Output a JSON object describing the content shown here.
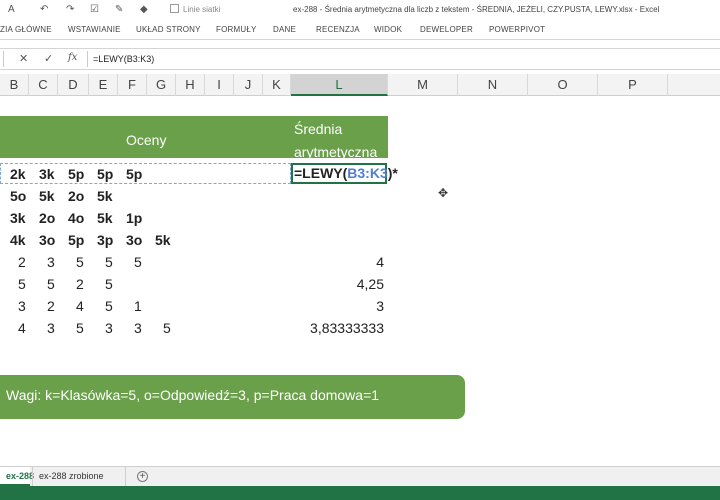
{
  "title_bar": {
    "gridlines_label": "Linie siatki",
    "window_title": "ex-288 - Średnia arytmetyczna dla liczb z tekstem - ŚREDNIA, JEŻELI, CZY.PUSTA, LEWY.xlsx - Excel"
  },
  "ribbon": {
    "tabs": [
      "ZIA GŁÓWNE",
      "WSTAWIANIE",
      "UKŁAD STRONY",
      "FORMUŁY",
      "DANE",
      "RECENZJA",
      "WIDOK",
      "DEWELOPER",
      "POWERPIVOT"
    ]
  },
  "formula_bar": {
    "cancel": "✕",
    "confirm": "✓",
    "fx": "fx",
    "formula": "=LEWY(B3:K3)"
  },
  "columns": [
    "B",
    "C",
    "D",
    "E",
    "F",
    "G",
    "H",
    "I",
    "J",
    "K",
    "L",
    "M",
    "N",
    "O",
    "P"
  ],
  "sheet": {
    "header_oceny": "Oceny",
    "header_srednia_1": "Średnia",
    "header_srednia_2": "arytmetyczna",
    "grade_rows": [
      [
        "2k",
        "3k",
        "5p",
        "5p",
        "5p",
        ""
      ],
      [
        "5o",
        "5k",
        "2o",
        "5k",
        "",
        ""
      ],
      [
        "3k",
        "2o",
        "4o",
        "5k",
        "1p",
        ""
      ],
      [
        "4k",
        "3o",
        "5p",
        "3p",
        "3o",
        "5k"
      ]
    ],
    "value_rows": [
      {
        "cells": [
          "2",
          "3",
          "5",
          "5",
          "5",
          ""
        ],
        "result": "4"
      },
      {
        "cells": [
          "5",
          "5",
          "2",
          "5",
          "",
          ""
        ],
        "result": "4,25"
      },
      {
        "cells": [
          "3",
          "2",
          "4",
          "5",
          "1",
          ""
        ],
        "result": "3"
      },
      {
        "cells": [
          "4",
          "3",
          "5",
          "3",
          "3",
          "5"
        ],
        "result": "3,83333333"
      }
    ],
    "edit_formula_prefix": "=LEWY(",
    "edit_formula_ref": "B3:K3",
    "edit_formula_suffix": ")*",
    "legend": "Wagi: k=Klasówka=5, o=Odpowiedź=3, p=Praca domowa=1"
  },
  "sheet_tabs": {
    "active": "ex-288",
    "other": "ex-288 zrobione",
    "add": "+"
  },
  "colors": {
    "header_green": "#6aa04a",
    "excel_green": "#217346",
    "ref_blue": "#4f7fd4"
  }
}
